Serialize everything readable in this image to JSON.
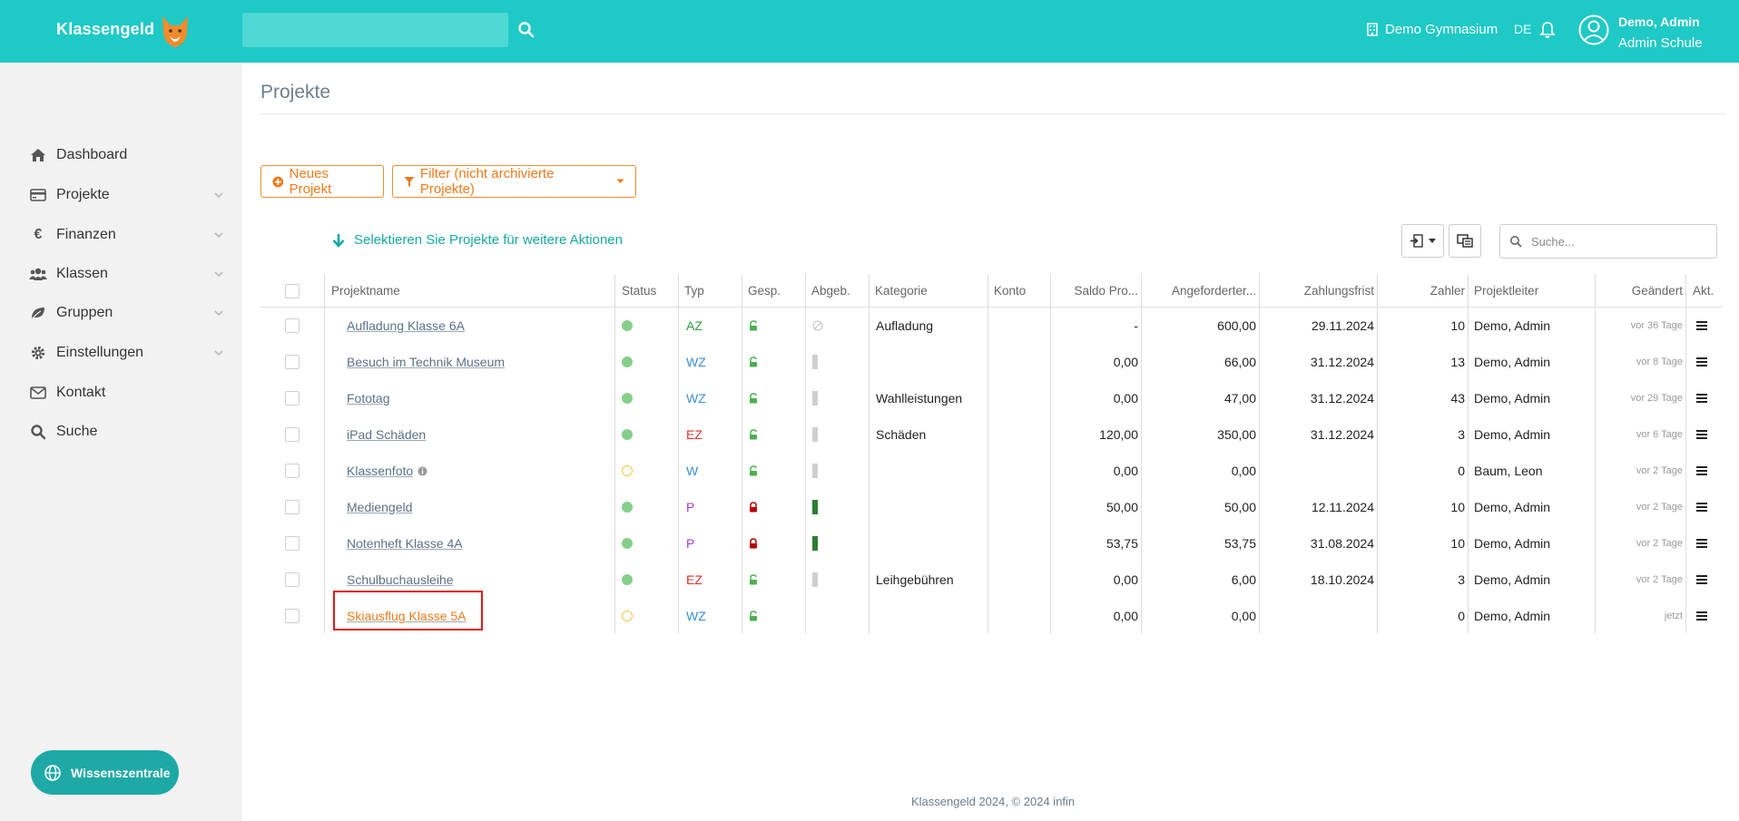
{
  "header": {
    "brand": "Klassengeld",
    "school": "Demo Gymnasium",
    "language": "DE",
    "user_name": "Demo, Admin",
    "user_role": "Admin Schule"
  },
  "sidebar": {
    "items": [
      {
        "label": "Dashboard",
        "icon": "home-icon",
        "chevron": false
      },
      {
        "label": "Projekte",
        "icon": "credit-card-icon",
        "chevron": true
      },
      {
        "label": "Finanzen",
        "icon": "euro-icon",
        "chevron": true
      },
      {
        "label": "Klassen",
        "icon": "users-icon",
        "chevron": true
      },
      {
        "label": "Gruppen",
        "icon": "leaf-icon",
        "chevron": true
      },
      {
        "label": "Einstellungen",
        "icon": "gear-icon",
        "chevron": true
      },
      {
        "label": "Kontakt",
        "icon": "envelope-icon",
        "chevron": false
      },
      {
        "label": "Suche",
        "icon": "search-icon",
        "chevron": false
      }
    ],
    "help_button": "Wissenszentrale"
  },
  "main": {
    "title": "Projekte",
    "new_project": "Neues Projekt",
    "filter": "Filter (nicht archivierte Projekte)",
    "select_hint": "Selektieren Sie Projekte für weitere Aktionen",
    "search_placeholder": "Suche..."
  },
  "table": {
    "columns": [
      "Projektname",
      "Status",
      "Typ",
      "Gesp.",
      "Abgeb.",
      "Kategorie",
      "Konto",
      "Saldo Pro...",
      "Angeforderter...",
      "Zahlungsfrist",
      "Zahler",
      "Projektleiter",
      "Geändert",
      "Akt."
    ],
    "rows": [
      {
        "name": "Aufladung Klasse 6A",
        "status": "green",
        "typ": "AZ",
        "typ_color": "#2e9e3e",
        "locked": false,
        "abgeb": "none",
        "kategorie": "Aufladung",
        "saldo": "-",
        "angefordert": "600,00",
        "frist": "29.11.2024",
        "zahler": "10",
        "leiter": "Demo, Admin",
        "geaendert": "vor 36 Tage",
        "info": false
      },
      {
        "name": "Besuch im Technik Museum",
        "status": "green",
        "typ": "WZ",
        "typ_color": "#3a8fd6",
        "locked": false,
        "abgeb": "grey",
        "kategorie": "",
        "saldo": "0,00",
        "angefordert": "66,00",
        "frist": "31.12.2024",
        "zahler": "13",
        "leiter": "Demo, Admin",
        "geaendert": "vor 8 Tage",
        "info": false
      },
      {
        "name": "Fototag",
        "status": "green",
        "typ": "WZ",
        "typ_color": "#3a8fd6",
        "locked": false,
        "abgeb": "grey",
        "kategorie": "Wahlleistungen",
        "saldo": "0,00",
        "angefordert": "47,00",
        "frist": "31.12.2024",
        "zahler": "43",
        "leiter": "Demo, Admin",
        "geaendert": "vor 29 Tage",
        "info": false
      },
      {
        "name": "iPad Schäden",
        "status": "green",
        "typ": "EZ",
        "typ_color": "#e0302a",
        "locked": false,
        "abgeb": "grey",
        "kategorie": "Schäden",
        "saldo": "120,00",
        "angefordert": "350,00",
        "frist": "31.12.2024",
        "zahler": "3",
        "leiter": "Demo, Admin",
        "geaendert": "vor 6 Tage",
        "info": false
      },
      {
        "name": "Klassenfoto",
        "status": "yellow",
        "typ": "W",
        "typ_color": "#3a8fd6",
        "locked": false,
        "abgeb": "grey",
        "kategorie": "",
        "saldo": "0,00",
        "angefordert": "0,00",
        "frist": "",
        "zahler": "0",
        "leiter": "Baum, Leon",
        "geaendert": "vor 2 Tage",
        "info": true
      },
      {
        "name": "Mediengeld",
        "status": "green",
        "typ": "P",
        "typ_color": "#a03cc8",
        "locked": true,
        "abgeb": "green",
        "kategorie": "",
        "saldo": "50,00",
        "angefordert": "50,00",
        "frist": "12.11.2024",
        "zahler": "10",
        "leiter": "Demo, Admin",
        "geaendert": "vor 2 Tage",
        "info": false
      },
      {
        "name": "Notenheft Klasse 4A",
        "status": "green",
        "typ": "P",
        "typ_color": "#a03cc8",
        "locked": true,
        "abgeb": "green",
        "kategorie": "",
        "saldo": "53,75",
        "angefordert": "53,75",
        "frist": "31.08.2024",
        "zahler": "10",
        "leiter": "Demo, Admin",
        "geaendert": "vor 2 Tage",
        "info": false
      },
      {
        "name": "Schulbuchausleihe",
        "status": "green",
        "typ": "EZ",
        "typ_color": "#e0302a",
        "locked": false,
        "abgeb": "grey",
        "kategorie": "Leihgebühren",
        "saldo": "0,00",
        "angefordert": "6,00",
        "frist": "18.10.2024",
        "zahler": "3",
        "leiter": "Demo, Admin",
        "geaendert": "vor 2 Tage",
        "info": false
      },
      {
        "name": "Skiausflug Klasse 5A",
        "status": "yellow",
        "typ": "WZ",
        "typ_color": "#3a8fd6",
        "locked": false,
        "abgeb": "empty",
        "kategorie": "",
        "saldo": "0,00",
        "angefordert": "0,00",
        "frist": "",
        "zahler": "0",
        "leiter": "Demo, Admin",
        "geaendert": "jetzt",
        "info": false
      }
    ]
  },
  "footer": "Klassengeld 2024, © 2024 infin"
}
